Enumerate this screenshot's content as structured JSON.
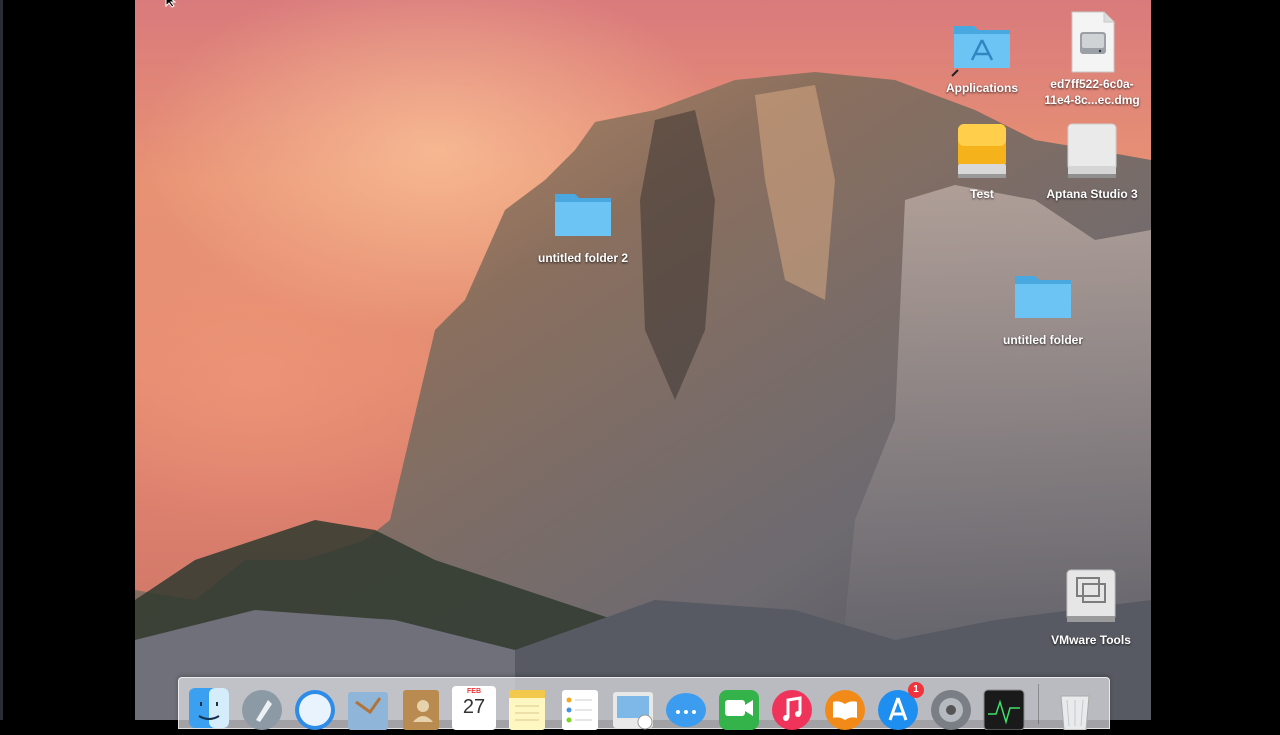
{
  "desktop_icons": {
    "applications": {
      "label": "Applications",
      "icon": "applications-folder-icon"
    },
    "dmg": {
      "label": "ed7ff522-6c0a-11e4-8c...ec.dmg",
      "icon": "disk-image-file-icon"
    },
    "test": {
      "label": "Test",
      "icon": "external-drive-icon"
    },
    "aptana": {
      "label": "Aptana Studio 3",
      "icon": "mounted-disk-icon"
    },
    "untitled_folder_2": {
      "label": "untitled folder 2",
      "icon": "folder-icon"
    },
    "untitled_folder": {
      "label": "untitled folder",
      "icon": "folder-icon"
    },
    "vmware_tools": {
      "label": "VMware Tools",
      "icon": "vmware-disk-icon"
    }
  },
  "dock": {
    "calendar": {
      "month": "FEB",
      "day": "27"
    },
    "app_store_badge": "1",
    "items": [
      "finder-icon",
      "launchpad-icon",
      "safari-icon",
      "mail-icon",
      "contacts-icon",
      "calendar-icon",
      "notes-icon",
      "reminders-icon",
      "photo-booth-icon",
      "messages-icon",
      "facetime-icon",
      "itunes-icon",
      "ibooks-icon",
      "app-store-icon",
      "system-preferences-icon",
      "activity-monitor-icon",
      "trash-icon"
    ]
  },
  "colors": {
    "folder_blue": "#5bbcf2",
    "drive_yellow": "#f6b21a",
    "badge_red": "#f0333c"
  }
}
